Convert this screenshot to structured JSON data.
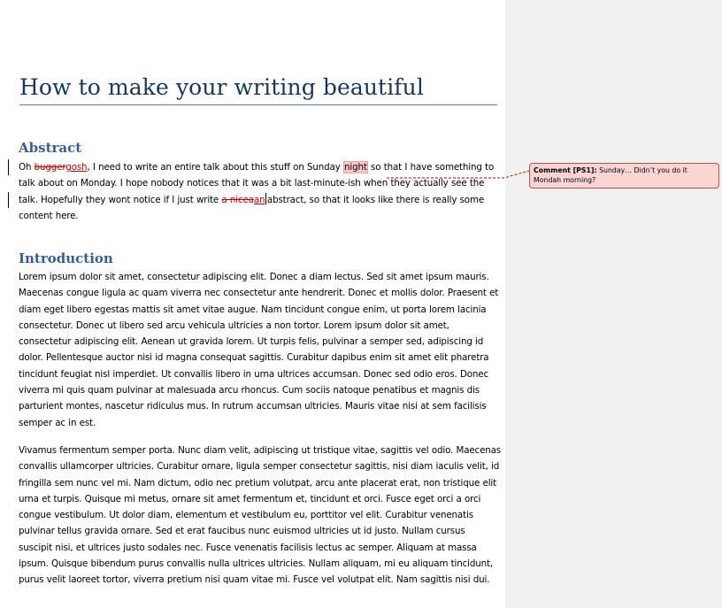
{
  "document": {
    "title": "How to make your writing beautiful",
    "abstract": {
      "heading": "Abstract",
      "lead_space": " ",
      "w1": "Oh ",
      "del1": "bugger",
      "ins1": "gosh",
      "t2": ", I need to write an entire talk about this stuff on Sunday ",
      "commented": "night",
      "t3": " so that I have something to talk about on Monday. I hope nobody notices that it was a bit last-minute-ish when they actually see the talk. Hopefully they wont notice if I just write ",
      "del2": "a nicea",
      "ins2": "an",
      "t4": "abstract, so that it looks like there is really some content here."
    },
    "introduction": {
      "heading": "Introduction",
      "paragraphs": [
        "Lorem ipsum dolor sit amet, consectetur adipiscing elit. Donec a diam lectus. Sed sit amet ipsum mauris. Maecenas congue ligula ac quam viverra nec consectetur ante hendrerit. Donec et mollis dolor. Praesent et diam eget libero egestas mattis  sit amet vitae  augue. Nam tincidunt congue enim, ut porta lorem lacinia consectetur. Donec ut libero sed arcu vehicula ultricies a  non tortor. Lorem ipsum dolor sit amet, consectetur adipiscing elit. Aenean ut gravida lorem. Ut turpis felis, pulvinar a semper sed, adipiscing id dolor. Pellentesque auctor nisi id magna  consequat sagittis.  Curabitur dapibus enim sit amet elit pharetra tincidunt feugiat nisl imperdiet. Ut convallis libero in urna ultrices accumsan. Donec sed odio eros. Donec viverra mi  quis quam pulvinar at malesuada arcu rhoncus. Cum sociis natoque penatibus et magnis  dis parturient montes,  nascetur ridiculus mus.  In rutrum accumsan ultricies. Mauris vitae nisi at sem facilisis semper ac in est.",
        "Vivamus fermentum semper porta.  Nunc diam velit, adipiscing ut tristique vitae, sagittis  vel odio. Maecenas convallis ullamcorper ultricies. Curabitur ornare, ligula semper consectetur sagittis,  nisi diam iaculis velit, id fringilla sem nunc vel mi. Nam  dictum, odio nec pretium volutpat, arcu ante placerat erat, non tristique elit urna et turpis. Quisque mi  metus,  ornare sit amet fermentum et, tincidunt et orci. Fusce eget orci a orci congue vestibulum. Ut dolor diam, elementum et vestibulum eu, porttitor vel elit.  Curabitur venenatis pulvinar tellus gravida  ornare. Sed et erat faucibus nunc euismod ultricies ut id justo.  Nullam cursus suscipit nisi, et ultrices justo sodales nec. Fusce venenatis facilisis lectus ac semper. Aliquam at massa ipsum.  Quisque bibendum purus convallis nulla ultrices ultricies. Nullam aliquam,  mi eu aliquam tincidunt, purus velit laoreet tortor, viverra pretium nisi quam vitae mi.  Fusce vel volutpat elit. Nam  sagittis nisi dui."
      ]
    }
  },
  "comment": {
    "label": "Comment [PS1]:",
    "text": " Sunday… Didn’t you do it Mondah morning?"
  },
  "colors": {
    "title": "#17365d",
    "heading": "#365f91",
    "revision": "#c00000",
    "comment_fill": "#fbd4d4",
    "comment_border": "#c0504d",
    "markup_pane": "#f1f1f1"
  }
}
